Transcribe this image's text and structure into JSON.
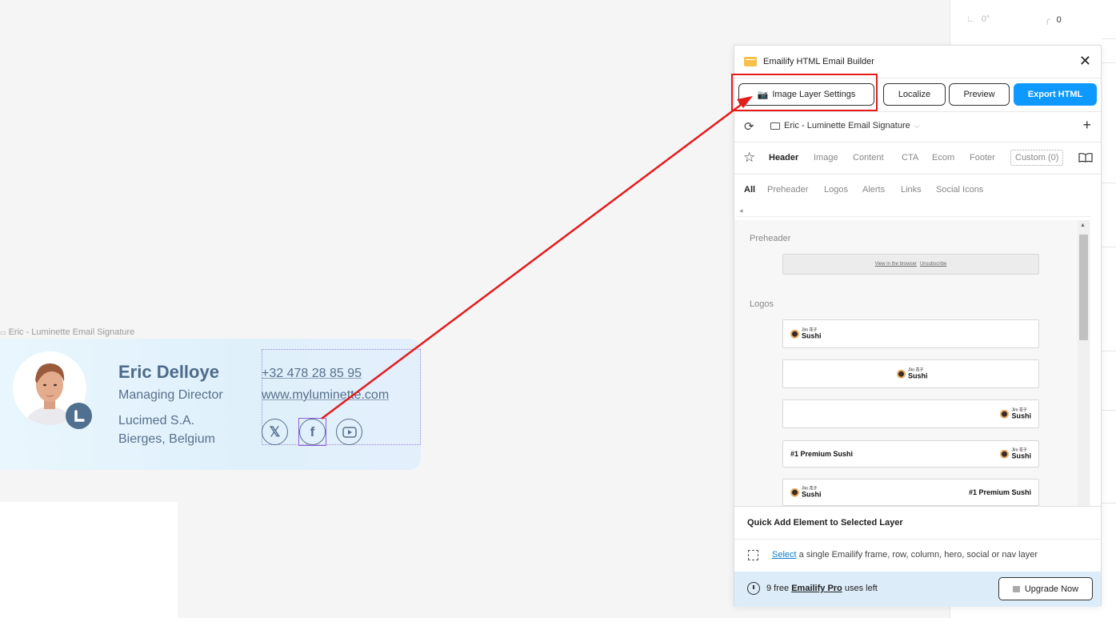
{
  "right_strip": {
    "angle_label": "0°",
    "radius_label": "0"
  },
  "canvas": {
    "frame_label": "Eric - Luminette Email Signature"
  },
  "signature": {
    "name": "Eric Delloye",
    "title": "Managing Director",
    "company": "Lucimed S.A.",
    "location": "Bierges, Belgium",
    "phone": "+32 478 28 85 95",
    "website": "www.myluminette.com",
    "social": [
      "x-icon",
      "facebook-icon",
      "youtube-icon"
    ]
  },
  "panel": {
    "title": "Emailify HTML Email Builder",
    "buttons": {
      "image_layer": "Image Layer Settings",
      "localize": "Localize",
      "preview": "Preview",
      "export": "Export HTML"
    },
    "frame_selector": "Eric - Luminette Email Signature",
    "tabs": [
      "Header",
      "Image",
      "Content",
      "CTA",
      "Ecom",
      "Footer"
    ],
    "custom_tab": "Custom (0)",
    "subtabs": [
      "All",
      "Preheader",
      "Logos",
      "Alerts",
      "Links",
      "Social Icons"
    ],
    "sections": {
      "preheader_label": "Preheader",
      "preheader_links": [
        "View in the browser",
        "Unsubscribe"
      ],
      "logos_label": "Logos",
      "sushi_small": "Jǐro 花子",
      "sushi_big": "Sushi",
      "premium_text": "#1 Premium Sushi"
    },
    "quick_add": "Quick Add Element to Selected Layer",
    "select_link": "Select",
    "select_rest": "a single Emailify frame, row, column, hero, social or nav layer",
    "footer": {
      "free_prefix": "9 free",
      "pro_link": "Emailify Pro",
      "free_suffix": "uses left",
      "upgrade": "Upgrade Now"
    }
  },
  "colors": {
    "accent": "#0d99ff",
    "annotation": "#e41c1c",
    "signature_text": "#4d6b89"
  }
}
